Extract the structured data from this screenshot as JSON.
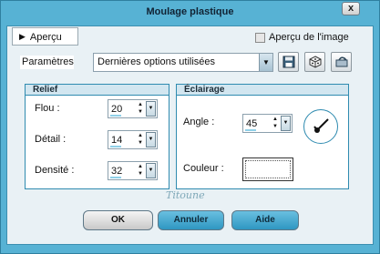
{
  "window": {
    "title": "Moulage plastique",
    "close_label": "x"
  },
  "preview": {
    "button_label": "Aperçu",
    "checkbox_label": "Aperçu de l'image",
    "checkbox_checked": false
  },
  "presets": {
    "label": "Paramètres",
    "selected": "Dernières options utilisées"
  },
  "toolbar": {
    "icons": [
      "save-icon",
      "randomize-icon",
      "reset-icon"
    ]
  },
  "relief": {
    "title": "Relief",
    "fields": [
      {
        "label": "Flou :",
        "value": "20"
      },
      {
        "label": "Détail :",
        "value": "14"
      },
      {
        "label": "Densité :",
        "value": "32"
      }
    ]
  },
  "lighting": {
    "title": "Éclairage",
    "angle_label": "Angle :",
    "angle_value": "45",
    "color_label": "Couleur :",
    "color_value": "#ffffff"
  },
  "watermark": "Titoune",
  "buttons": {
    "ok": "OK",
    "cancel": "Annuler",
    "help": "Aide"
  },
  "colors": {
    "frame": "#57b2d4",
    "client": "#e9f1f5",
    "accent": "#2f8bb0"
  }
}
